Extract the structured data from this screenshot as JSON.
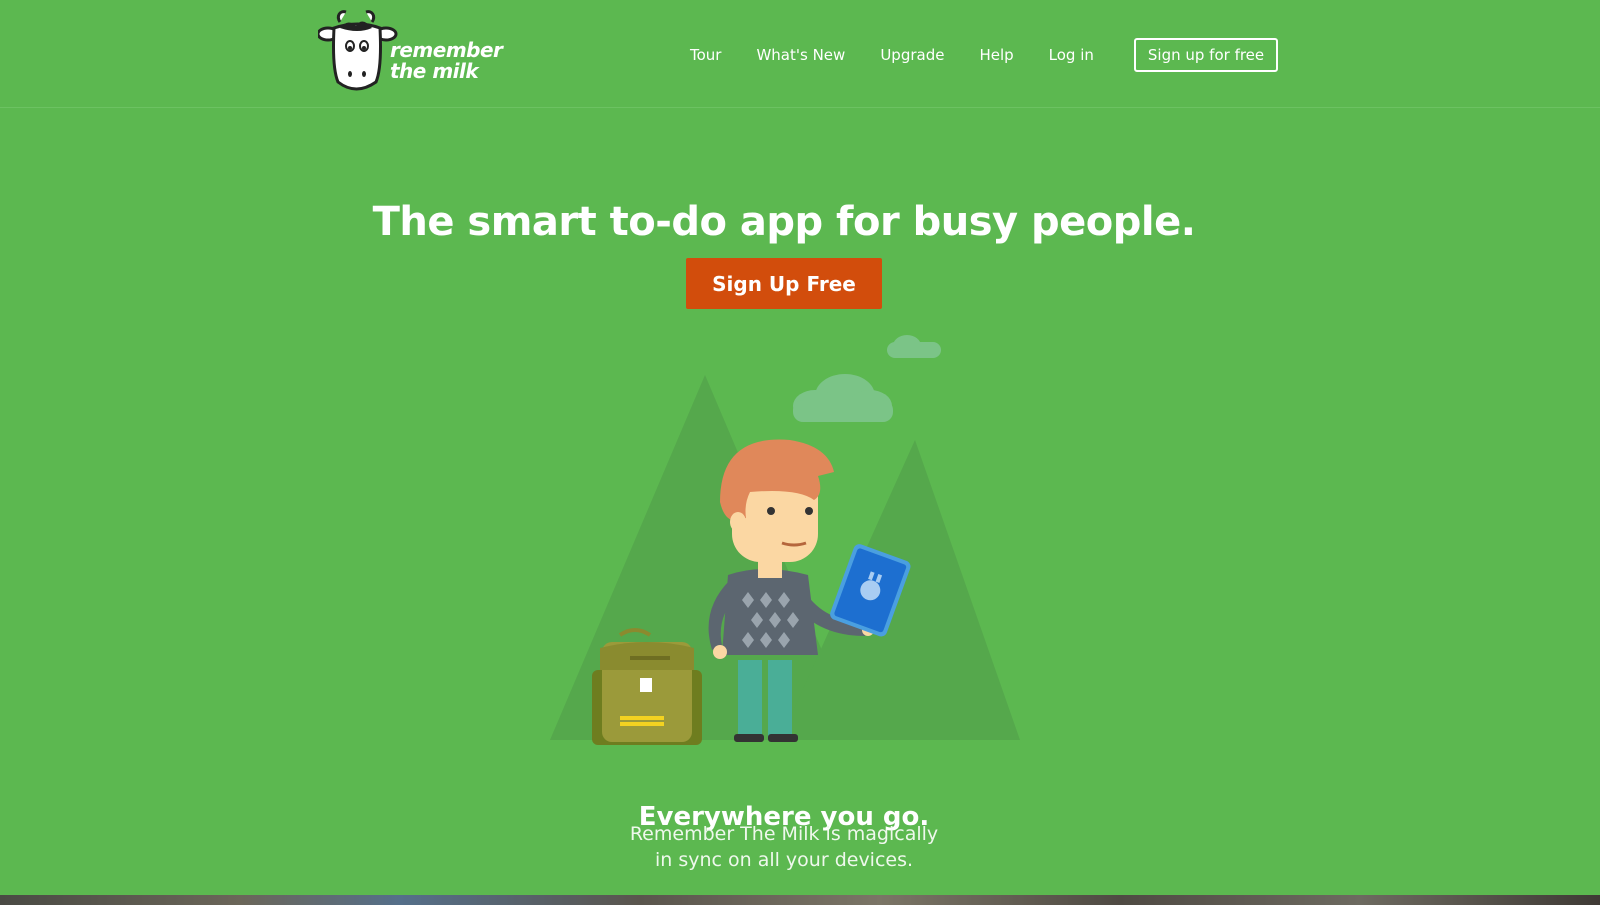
{
  "brand": {
    "line1": "remember",
    "line2": "the milk",
    "logo_icon": "cow-head-icon"
  },
  "nav": {
    "items": [
      {
        "label": "Tour"
      },
      {
        "label": "What's New"
      },
      {
        "label": "Upgrade"
      },
      {
        "label": "Help"
      },
      {
        "label": "Log in"
      }
    ],
    "signup_label": "Sign up for free"
  },
  "hero": {
    "title": "The smart to-do app for busy people.",
    "cta_label": "Sign Up Free",
    "cta_color": "#d24d0c",
    "background": "#5cb850"
  },
  "illustration": {
    "icons": [
      "tree-icon",
      "cloud-icon",
      "person-icon",
      "tablet-icon",
      "backpack-icon"
    ]
  },
  "feature": {
    "title": "Everywhere you go.",
    "line1": "Remember The Milk is magically",
    "line2": "in sync on all your devices."
  }
}
